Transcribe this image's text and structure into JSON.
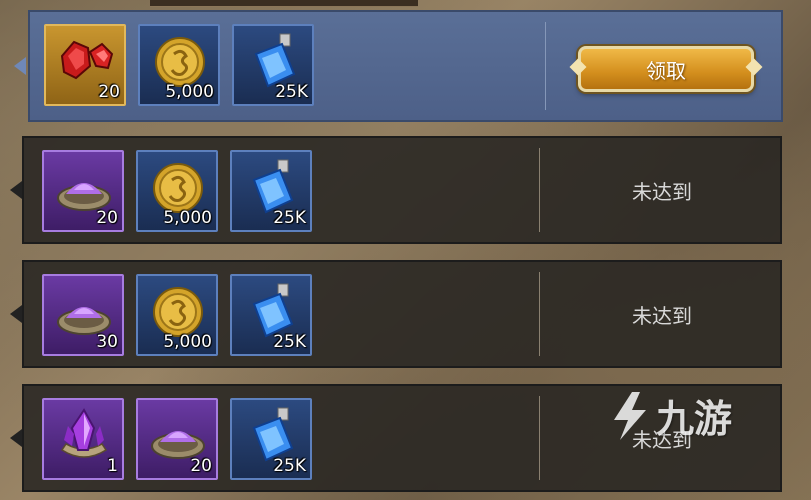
{
  "rows": [
    {
      "active": true,
      "status": "领取",
      "items": [
        {
          "icon": "ruby-icon",
          "qty": "20",
          "frame": "gold"
        },
        {
          "icon": "gold-coin-icon",
          "qty": "5,000",
          "frame": "blue"
        },
        {
          "icon": "potion-icon",
          "qty": "25K",
          "frame": "blue"
        }
      ]
    },
    {
      "active": false,
      "status": "未达到",
      "items": [
        {
          "icon": "purple-dust-icon",
          "qty": "20",
          "frame": "purple"
        },
        {
          "icon": "gold-coin-icon",
          "qty": "5,000",
          "frame": "blue"
        },
        {
          "icon": "potion-icon",
          "qty": "25K",
          "frame": "blue"
        }
      ]
    },
    {
      "active": false,
      "status": "未达到",
      "items": [
        {
          "icon": "purple-dust-icon",
          "qty": "30",
          "frame": "purple"
        },
        {
          "icon": "gold-coin-icon",
          "qty": "5,000",
          "frame": "blue"
        },
        {
          "icon": "potion-icon",
          "qty": "25K",
          "frame": "blue"
        }
      ]
    },
    {
      "active": false,
      "status": "未达到",
      "items": [
        {
          "icon": "purple-crystal-icon",
          "qty": "1",
          "frame": "purple"
        },
        {
          "icon": "purple-dust-icon",
          "qty": "20",
          "frame": "purple"
        },
        {
          "icon": "potion-icon",
          "qty": "25K",
          "frame": "blue"
        }
      ]
    }
  ],
  "watermark": {
    "text": "九游"
  }
}
